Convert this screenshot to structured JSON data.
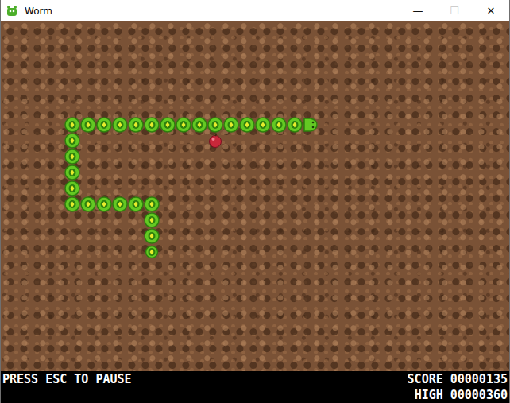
{
  "window": {
    "title": "Worm",
    "controls": [
      {
        "glyph": "—",
        "disabled": false
      },
      {
        "glyph": "☐",
        "disabled": true
      },
      {
        "glyph": "✕",
        "disabled": false
      }
    ]
  },
  "worm": {
    "direction": "right",
    "segments": [
      {
        "kind": "head",
        "cell": [
          19,
          6
        ]
      },
      {
        "kind": "body",
        "cell": [
          18,
          6
        ]
      },
      {
        "kind": "body",
        "cell": [
          17,
          6
        ]
      },
      {
        "kind": "body",
        "cell": [
          16,
          6
        ]
      },
      {
        "kind": "body",
        "cell": [
          15,
          6
        ]
      },
      {
        "kind": "body",
        "cell": [
          14,
          6
        ]
      },
      {
        "kind": "body",
        "cell": [
          13,
          6
        ]
      },
      {
        "kind": "body",
        "cell": [
          12,
          6
        ]
      },
      {
        "kind": "body",
        "cell": [
          11,
          6
        ]
      },
      {
        "kind": "body",
        "cell": [
          10,
          6
        ]
      },
      {
        "kind": "body",
        "cell": [
          9,
          6
        ]
      },
      {
        "kind": "body",
        "cell": [
          8,
          6
        ]
      },
      {
        "kind": "body",
        "cell": [
          7,
          6
        ]
      },
      {
        "kind": "body",
        "cell": [
          6,
          6
        ]
      },
      {
        "kind": "body",
        "cell": [
          5,
          6
        ]
      },
      {
        "kind": "body",
        "cell": [
          4,
          6
        ]
      },
      {
        "kind": "body",
        "cell": [
          4,
          7
        ]
      },
      {
        "kind": "body",
        "cell": [
          4,
          8
        ]
      },
      {
        "kind": "body",
        "cell": [
          4,
          9
        ]
      },
      {
        "kind": "body",
        "cell": [
          4,
          10
        ]
      },
      {
        "kind": "body",
        "cell": [
          4,
          11
        ]
      },
      {
        "kind": "body",
        "cell": [
          5,
          11
        ]
      },
      {
        "kind": "body",
        "cell": [
          6,
          11
        ]
      },
      {
        "kind": "body",
        "cell": [
          7,
          11
        ]
      },
      {
        "kind": "body",
        "cell": [
          8,
          11
        ]
      },
      {
        "kind": "body",
        "cell": [
          9,
          11
        ]
      },
      {
        "kind": "body",
        "cell": [
          9,
          12
        ]
      },
      {
        "kind": "body",
        "cell": [
          9,
          13
        ]
      },
      {
        "kind": "tail",
        "cell": [
          9,
          14
        ]
      }
    ]
  },
  "apple": {
    "cell": [
      13,
      7
    ]
  },
  "status_bar": {
    "hint": "PRESS ESC TO PAUSE",
    "score_label": "SCORE",
    "score": "00000135",
    "high_label": "HIGH",
    "high": "00000360"
  }
}
